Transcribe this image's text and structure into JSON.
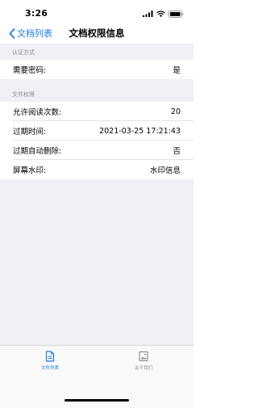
{
  "status_bar": {
    "time": "3:26"
  },
  "nav": {
    "back_label": "文档列表",
    "title": "文档权限信息"
  },
  "sections": [
    {
      "header": "认证方式",
      "rows": [
        {
          "label": "需要密码:",
          "value": "是"
        }
      ]
    },
    {
      "header": "文件权限",
      "rows": [
        {
          "label": "允许阅读次数:",
          "value": "20"
        },
        {
          "label": "过期时间:",
          "value": "2021-03-25 17:21:43"
        },
        {
          "label": "过期自动删除:",
          "value": "否"
        },
        {
          "label": "屏幕水印:",
          "value": "水印信息"
        }
      ]
    }
  ],
  "tabs": [
    {
      "label": "文件列表",
      "icon": "document-icon",
      "active": true
    },
    {
      "label": "关于我们",
      "icon": "photo-icon",
      "active": false
    }
  ],
  "colors": {
    "accent": "#1e7cf6",
    "background": "#f0f0f4"
  }
}
